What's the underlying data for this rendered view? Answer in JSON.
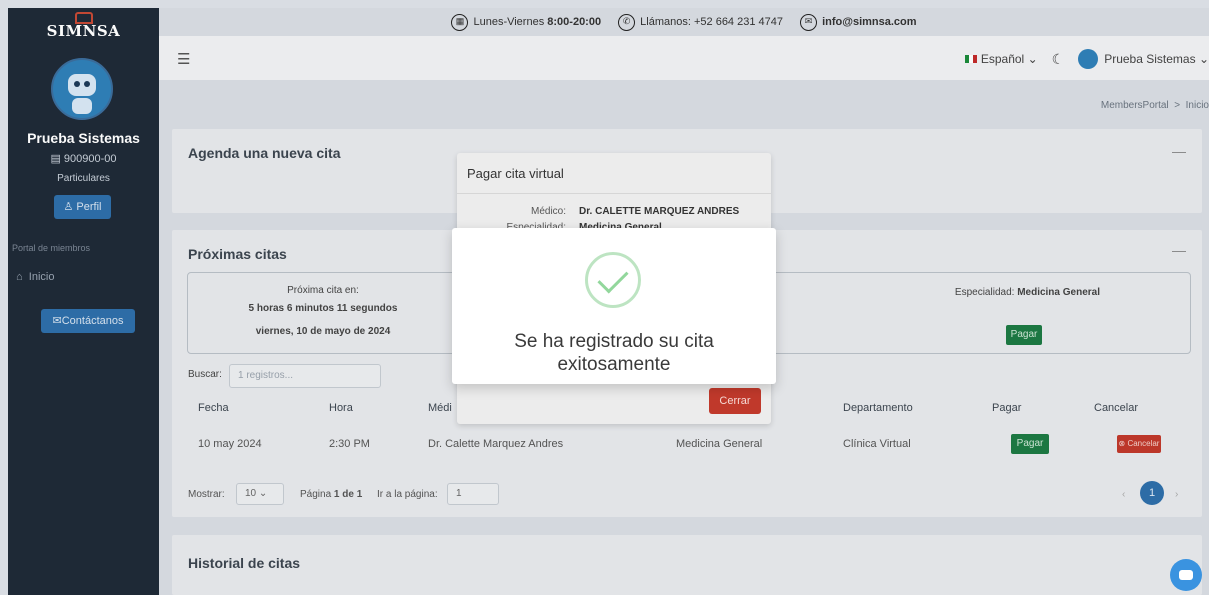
{
  "brand": {
    "name": "SIMNSA"
  },
  "sidebar": {
    "user_name": "Prueba Sistemas",
    "user_id": "900900-00",
    "user_group": "Particulares",
    "perfil_label": "Perfil",
    "section_label": "Portal de miembros",
    "nav_inicio": "Inicio",
    "contact_label": "Contáctanos"
  },
  "topinfo": {
    "hours_prefix": "Lunes-Viernes",
    "hours": "8:00-20:00",
    "phone_prefix": "Llámanos:",
    "phone": "+52 664 231 4747",
    "email": "info@simnsa.com"
  },
  "header": {
    "language": "Español",
    "user": "Prueba Sistemas"
  },
  "breadcrumb": {
    "root": "MembersPortal",
    "sep": ">",
    "current": "Inicio"
  },
  "cards": {
    "agenda_title": "Agenda una nueva cita",
    "proximas_title": "Próximas citas",
    "historial_title": "Historial de citas"
  },
  "next": {
    "label": "Próxima cita en:",
    "countdown": "5 horas 6 minutos 11 segundos",
    "date": "viernes, 10 de mayo de 2024",
    "spec_label": "Especialidad:",
    "spec_value": "Medicina General",
    "pay": "Pagar"
  },
  "table": {
    "search_label": "Buscar:",
    "search_placeholder": "1 registros...",
    "headers": [
      "Fecha",
      "Hora",
      "Médi",
      "Departamento",
      "Pagar",
      "Cancelar"
    ],
    "row": {
      "fecha": "10 may 2024",
      "hora": "2:30 PM",
      "medico": "Dr. Calette Marquez Andres",
      "especialidad": "Medicina General",
      "departamento": "Clínica Virtual",
      "pagar": "Pagar",
      "cancelar": "Cancelar"
    },
    "show_label": "Mostrar:",
    "show_value": "10",
    "page_info_prefix": "Página",
    "page_info_num": "1 de 1",
    "goto_label": "Ir a la página:",
    "goto_value": "1",
    "current_page": "1"
  },
  "pay_modal": {
    "title": "Pagar cita virtual",
    "medico_label": "Médico:",
    "medico_value": "Dr. CALETTE MARQUEZ ANDRES",
    "spec_label": "Especialidad:",
    "spec_value": "Medicina General",
    "close": "Cerrar"
  },
  "alert": {
    "message": "Se ha registrado su cita exitosamente"
  },
  "colors": {
    "sidebar": "#1f2a38",
    "primary": "#2e6faa",
    "success": "#1d7a44",
    "danger": "#c0392b"
  }
}
